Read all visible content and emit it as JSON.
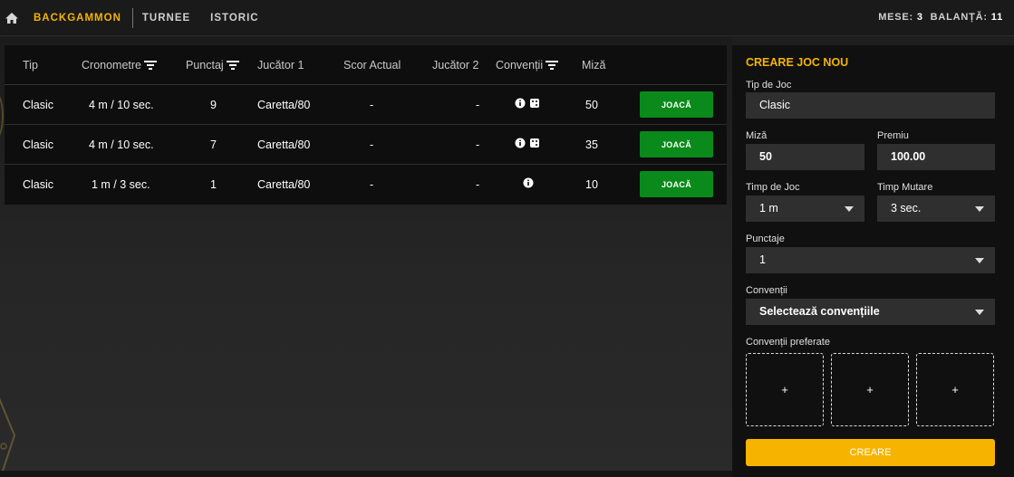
{
  "nav": {
    "items": [
      "BACKGAMMON",
      "TURNEE",
      "ISTORIC"
    ],
    "active": 0
  },
  "stats": {
    "tables_label": "MESE:",
    "tables_value": "3",
    "balance_label": "BALANȚĂ:",
    "balance_value": "11"
  },
  "table": {
    "headers": [
      "Tip",
      "Cronometre",
      "Punctaj",
      "Jucător 1",
      "Scor Actual",
      "Jucător 2",
      "Convenții",
      "Miză"
    ],
    "rows": [
      {
        "tip": "Clasic",
        "cronometre": "4 m / 10 sec.",
        "punctaj": "9",
        "jucator1": "Caretta/80",
        "scor": "-",
        "jucator2": "-",
        "conventii": [
          "info-icon",
          "dice-icon"
        ],
        "miza": "50",
        "action": "JOACĂ"
      },
      {
        "tip": "Clasic",
        "cronometre": "4 m / 10 sec.",
        "punctaj": "7",
        "jucator1": "Caretta/80",
        "scor": "-",
        "jucator2": "-",
        "conventii": [
          "info-icon",
          "dice-icon"
        ],
        "miza": "35",
        "action": "JOACĂ"
      },
      {
        "tip": "Clasic",
        "cronometre": "1 m / 3 sec.",
        "punctaj": "1",
        "jucator1": "Caretta/80",
        "scor": "-",
        "jucator2": "-",
        "conventii": [
          "info-icon"
        ],
        "miza": "10",
        "action": "JOACĂ"
      }
    ]
  },
  "create": {
    "title": "CREARE JOC NOU",
    "game_type_label": "Tip de Joc",
    "game_type_value": "Clasic",
    "stake_label": "Miză",
    "stake_value": "50",
    "prize_label": "Premiu",
    "prize_value": "100.00",
    "game_time_label": "Timp de Joc",
    "game_time_value": "1 m",
    "move_time_label": "Timp Mutare",
    "move_time_value": "3 sec.",
    "points_label": "Punctaje",
    "points_value": "1",
    "conventions_label": "Convenții",
    "conventions_value": "Selectează convențiile",
    "preferred_label": "Convenții preferate",
    "slots": [
      "+",
      "+",
      "+"
    ],
    "button": "CREARE"
  },
  "colors": {
    "accent": "#f5b400",
    "play_button": "#0a8a1a",
    "create_button": "#f6b400"
  }
}
